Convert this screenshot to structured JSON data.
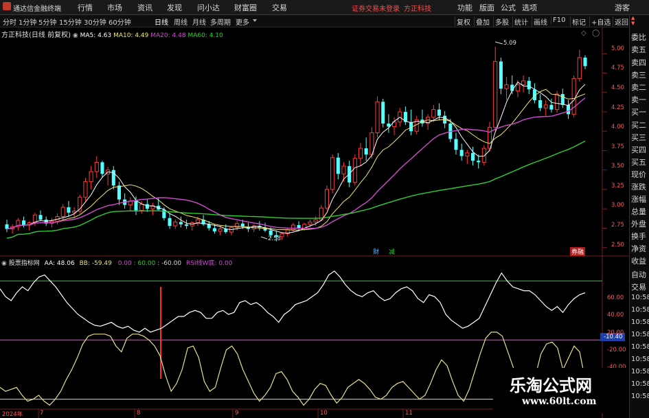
{
  "app": {
    "name": "通达信金融终端",
    "status_text": "证券交易未登录",
    "stock_title": "方正科技"
  },
  "menu": [
    "行情",
    "市场",
    "资讯",
    "发现",
    "问小达",
    "财富圈",
    "交易"
  ],
  "top_right": [
    "功能",
    "版面",
    "公式",
    "选项"
  ],
  "top_far_right": "游客",
  "periods": [
    "分时",
    "1分钟",
    "5分钟",
    "15分钟",
    "30分钟",
    "60分钟",
    "日线",
    "周线",
    "月线",
    "多周期",
    "更多"
  ],
  "active_period": "日线",
  "right_buttons": [
    "复权",
    "叠加",
    "多股",
    "统计",
    "画线",
    "F10",
    "标记",
    "+自选",
    "返回"
  ],
  "legend_main": {
    "title": "方正科技(日线 前复权)",
    "ma5": "MA5: 4.63",
    "ma10": "MA10: 4.49",
    "ma20": "MA20: 4.48",
    "ma60": "MA60: 4.10"
  },
  "legend_sub": {
    "title": "股票指标网",
    "aa": "AA: 48.06",
    "bb": "BB: -59.49",
    "c1": "0.00",
    "c2": ": 60.00",
    "c3": ": -60.00",
    "rsi": "RSI线W底: 0.00"
  },
  "side_items": [
    "委比",
    "卖五",
    "卖四",
    "卖三",
    "卖二",
    "卖一",
    "买一",
    "买二",
    "买三",
    "买四",
    "买五",
    "现价",
    "涨跌",
    "涨幅",
    "总量",
    "外盘",
    "换手",
    "净资",
    "收益",
    "自动",
    "交易",
    "10:58",
    "10:58",
    "10:58",
    "10:58",
    "10:58",
    "10:58",
    "10:58",
    "10:58",
    "10:58"
  ],
  "price_axis": [
    "5.00",
    "4.75",
    "4.50",
    "4.25",
    "4.00",
    "3.75",
    "3.50",
    "3.25",
    "3.00",
    "2.75",
    "2.50"
  ],
  "osc_axis": [
    "60.00",
    "40.00",
    "20.00",
    "-10.40",
    "-20.00",
    "-40.00"
  ],
  "date_axis": [
    "2024年",
    "7",
    "8",
    "9",
    "10",
    "11"
  ],
  "annotations": {
    "high": "5.09",
    "low": "2.58"
  },
  "markers": [
    "财",
    "减",
    "券融"
  ],
  "watermark": {
    "line1": "乐淘公式网",
    "line2": "www.60lt.com"
  },
  "colors": {
    "up": "#ff3b3b",
    "down": "#54ffff",
    "ma5": "#ffffff",
    "ma10": "#f5e76c",
    "ma20": "#d04cd0",
    "ma60": "#2fcf2f",
    "aa": "#ffffff",
    "bb": "#e8e08c",
    "axis_label": "#ff5a5a",
    "menu_bg": "#1a1a1a"
  },
  "chart_data": [
    {
      "type": "candlestick",
      "title": "方正科技(日线 前复权)",
      "ohlc": [
        [
          2.8,
          2.86,
          2.7,
          2.74
        ],
        [
          2.74,
          2.8,
          2.68,
          2.77
        ],
        [
          2.77,
          2.88,
          2.72,
          2.85
        ],
        [
          2.85,
          2.9,
          2.76,
          2.79
        ],
        [
          2.79,
          2.84,
          2.72,
          2.82
        ],
        [
          2.82,
          2.95,
          2.78,
          2.92
        ],
        [
          2.92,
          2.98,
          2.84,
          2.86
        ],
        [
          2.86,
          2.9,
          2.78,
          2.81
        ],
        [
          2.81,
          2.88,
          2.76,
          2.84
        ],
        [
          2.84,
          2.94,
          2.8,
          2.9
        ],
        [
          2.9,
          3.06,
          2.86,
          3.02
        ],
        [
          3.02,
          3.1,
          2.9,
          2.95
        ],
        [
          2.95,
          3.02,
          2.88,
          2.97
        ],
        [
          2.97,
          3.18,
          2.94,
          3.15
        ],
        [
          3.15,
          3.4,
          3.1,
          3.35
        ],
        [
          3.35,
          3.55,
          3.25,
          3.48
        ],
        [
          3.48,
          3.68,
          3.4,
          3.6
        ],
        [
          3.6,
          3.62,
          3.4,
          3.45
        ],
        [
          3.45,
          3.54,
          3.3,
          3.5
        ],
        [
          3.5,
          3.55,
          3.25,
          3.3
        ],
        [
          3.3,
          3.35,
          3.05,
          3.12
        ],
        [
          3.12,
          3.2,
          3.0,
          3.05
        ],
        [
          3.05,
          3.15,
          2.98,
          3.1
        ],
        [
          3.1,
          3.16,
          2.92,
          2.98
        ],
        [
          2.98,
          3.1,
          2.94,
          3.06
        ],
        [
          3.06,
          3.12,
          2.96,
          3.0
        ],
        [
          3.0,
          3.08,
          2.92,
          3.04
        ],
        [
          3.04,
          3.14,
          2.98,
          2.99
        ],
        [
          2.99,
          3.02,
          2.85,
          2.88
        ],
        [
          2.88,
          2.94,
          2.74,
          2.78
        ],
        [
          2.78,
          2.86,
          2.74,
          2.83
        ],
        [
          2.83,
          2.9,
          2.76,
          2.8
        ],
        [
          2.8,
          2.86,
          2.74,
          2.78
        ],
        [
          2.78,
          2.84,
          2.72,
          2.82
        ],
        [
          2.82,
          2.9,
          2.78,
          2.86
        ],
        [
          2.86,
          2.92,
          2.78,
          2.8
        ],
        [
          2.8,
          2.84,
          2.72,
          2.75
        ],
        [
          2.75,
          2.8,
          2.68,
          2.71
        ],
        [
          2.71,
          2.78,
          2.66,
          2.74
        ],
        [
          2.74,
          2.8,
          2.68,
          2.7
        ],
        [
          2.7,
          2.78,
          2.66,
          2.76
        ],
        [
          2.76,
          2.84,
          2.72,
          2.81
        ],
        [
          2.81,
          2.86,
          2.74,
          2.77
        ],
        [
          2.77,
          2.82,
          2.7,
          2.74
        ],
        [
          2.74,
          2.8,
          2.7,
          2.78
        ],
        [
          2.78,
          2.84,
          2.72,
          2.76
        ],
        [
          2.76,
          2.82,
          2.7,
          2.72
        ],
        [
          2.72,
          2.76,
          2.62,
          2.66
        ],
        [
          2.66,
          2.72,
          2.58,
          2.64
        ],
        [
          2.64,
          2.7,
          2.6,
          2.68
        ],
        [
          2.68,
          2.76,
          2.64,
          2.73
        ],
        [
          2.73,
          2.82,
          2.7,
          2.79
        ],
        [
          2.79,
          2.84,
          2.72,
          2.75
        ],
        [
          2.75,
          2.82,
          2.72,
          2.8
        ],
        [
          2.8,
          2.86,
          2.76,
          2.83
        ],
        [
          2.83,
          2.9,
          2.78,
          2.86
        ],
        [
          2.86,
          3.05,
          2.84,
          3.01
        ],
        [
          3.01,
          3.3,
          2.98,
          3.25
        ],
        [
          3.25,
          3.7,
          3.2,
          3.66
        ],
        [
          3.66,
          3.72,
          3.38,
          3.45
        ],
        [
          3.45,
          3.6,
          3.35,
          3.55
        ],
        [
          3.55,
          3.62,
          3.28,
          3.34
        ],
        [
          3.34,
          3.7,
          3.3,
          3.65
        ],
        [
          3.65,
          3.85,
          3.55,
          3.78
        ],
        [
          3.78,
          3.92,
          3.62,
          3.7
        ],
        [
          3.7,
          4.05,
          3.65,
          3.98
        ],
        [
          3.98,
          4.45,
          3.92,
          4.38
        ],
        [
          4.38,
          4.42,
          4.05,
          4.1
        ],
        [
          4.1,
          4.22,
          3.98,
          4.06
        ],
        [
          4.06,
          4.18,
          3.95,
          4.12
        ],
        [
          4.12,
          4.3,
          4.06,
          4.25
        ],
        [
          4.25,
          4.32,
          4.08,
          4.12
        ],
        [
          4.12,
          4.28,
          3.95,
          4.0
        ],
        [
          4.0,
          4.2,
          3.96,
          4.15
        ],
        [
          4.15,
          4.28,
          4.06,
          4.1
        ],
        [
          4.1,
          4.22,
          4.02,
          4.18
        ],
        [
          4.18,
          4.34,
          4.12,
          4.28
        ],
        [
          4.28,
          4.36,
          4.14,
          4.2
        ],
        [
          4.2,
          4.26,
          4.04,
          4.1
        ],
        [
          4.1,
          4.16,
          3.86,
          3.9
        ],
        [
          3.9,
          3.98,
          3.7,
          3.76
        ],
        [
          3.76,
          3.84,
          3.62,
          3.68
        ],
        [
          3.68,
          3.76,
          3.58,
          3.72
        ],
        [
          3.72,
          3.8,
          3.56,
          3.62
        ],
        [
          3.62,
          3.7,
          3.52,
          3.6
        ],
        [
          3.6,
          3.82,
          3.56,
          3.78
        ],
        [
          3.78,
          4.12,
          3.74,
          4.05
        ],
        [
          4.05,
          5.09,
          4.0,
          4.9
        ],
        [
          4.9,
          4.95,
          4.48,
          4.55
        ],
        [
          4.55,
          4.7,
          4.4,
          4.6
        ],
        [
          4.6,
          4.72,
          4.48,
          4.52
        ],
        [
          4.52,
          4.66,
          4.44,
          4.6
        ],
        [
          4.6,
          4.72,
          4.5,
          4.65
        ],
        [
          4.65,
          4.7,
          4.48,
          4.54
        ],
        [
          4.54,
          4.62,
          4.36,
          4.4
        ],
        [
          4.4,
          4.48,
          4.26,
          4.3
        ],
        [
          4.3,
          4.4,
          4.2,
          4.34
        ],
        [
          4.34,
          4.42,
          4.24,
          4.28
        ],
        [
          4.28,
          4.52,
          4.24,
          4.48
        ],
        [
          4.48,
          4.55,
          4.3,
          4.34
        ],
        [
          4.34,
          4.4,
          4.16,
          4.22
        ],
        [
          4.22,
          4.72,
          4.18,
          4.68
        ],
        [
          4.68,
          5.05,
          4.64,
          4.95
        ],
        [
          4.95,
          4.98,
          4.8,
          4.84
        ]
      ],
      "ma": {
        "MA5": 4.63,
        "MA10": 4.49,
        "MA20": 4.48,
        "MA60": 4.1
      },
      "annotations": {
        "high": 5.09,
        "low": 2.58
      },
      "ylim": [
        2.4,
        5.25
      ]
    },
    {
      "type": "line",
      "title": "股票指标网",
      "series": [
        {
          "name": "AA",
          "values": [
            52,
            44,
            40,
            48,
            54,
            50,
            58,
            64,
            66,
            60,
            54,
            46,
            38,
            32,
            26,
            22,
            18,
            15,
            14,
            16,
            18,
            14,
            12,
            14,
            10,
            8,
            12,
            8,
            10,
            12,
            16,
            20,
            24,
            24,
            28,
            30,
            28,
            22,
            22,
            28,
            30,
            26,
            28,
            38,
            40,
            36,
            38,
            34,
            28,
            24,
            18,
            26,
            30,
            36,
            38,
            40,
            44,
            48,
            56,
            66,
            70,
            64,
            56,
            50,
            46,
            44,
            48,
            50,
            44,
            40,
            42,
            48,
            52,
            54,
            50,
            42,
            38,
            46,
            44,
            38,
            26,
            20,
            16,
            12,
            14,
            18,
            22,
            34,
            46,
            58,
            68,
            60,
            54,
            52,
            50,
            50,
            46,
            40,
            34,
            30,
            34,
            28,
            36,
            42,
            46,
            48
          ]
        },
        {
          "name": "BB",
          "values": [
            -48,
            -52,
            -50,
            -48,
            -56,
            -62,
            -60,
            -56,
            -62,
            -66,
            -60,
            -52,
            -40,
            -30,
            -18,
            -4,
            4,
            6,
            6,
            6,
            4,
            -6,
            -12,
            2,
            6,
            6,
            4,
            0,
            -6,
            -16,
            -36,
            -52,
            -44,
            -30,
            -8,
            -6,
            -18,
            -42,
            -52,
            -48,
            -28,
            -10,
            -6,
            -14,
            -30,
            -42,
            -54,
            -62,
            -56,
            -48,
            -34,
            -32,
            -40,
            -52,
            -58,
            -66,
            -60,
            -50,
            -44,
            -46,
            -56,
            -64,
            -58,
            -48,
            -44,
            -40,
            -44,
            -50,
            -58,
            -60,
            -56,
            -48,
            -44,
            -42,
            -48,
            -54,
            -60,
            -56,
            -44,
            -30,
            -20,
            -26,
            -42,
            -56,
            -62,
            -50,
            -32,
            -14,
            2,
            8,
            8,
            4,
            -12,
            -28,
            -44,
            -56,
            -62,
            -36,
            -14,
            -4,
            -2,
            -8,
            -30,
            -18,
            -6,
            -12,
            -40
          ]
        }
      ],
      "levels": {
        "upper": 60,
        "zero": 0,
        "lower": -60
      },
      "ylim": [
        -70,
        72
      ]
    }
  ]
}
